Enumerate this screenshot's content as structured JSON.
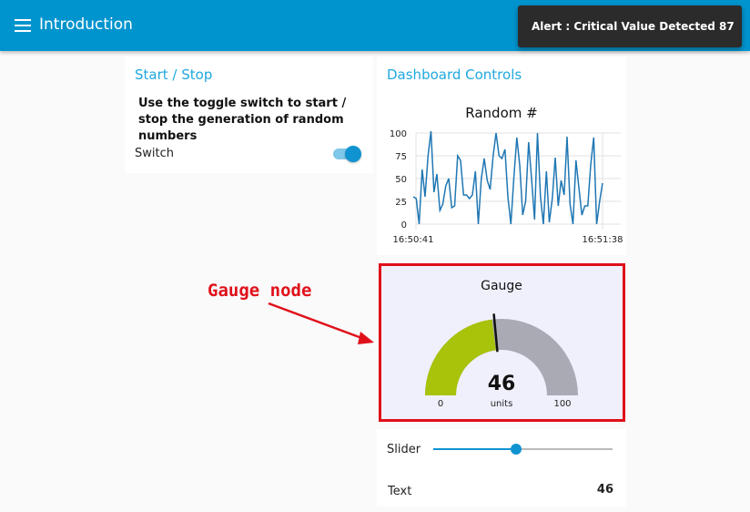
{
  "header": {
    "title": "Introduction",
    "menu_icon": "hamburger-menu-icon",
    "accent_color": "#0094ce"
  },
  "toast": {
    "message": "Alert : Critical Value Detected 87"
  },
  "start_stop": {
    "title": "Start / Stop",
    "description": "Use the toggle switch to start / stop the generation of random numbers",
    "switch_label": "Switch",
    "switch_on": true
  },
  "dashboard": {
    "title": "Dashboard Controls"
  },
  "chart_data": {
    "type": "line",
    "title": "Random #",
    "xlabel": "",
    "ylabel": "",
    "x_tick_labels": [
      "16:50:41",
      "16:51:38"
    ],
    "y_ticks": [
      0,
      25,
      50,
      75,
      100
    ],
    "ylim": [
      0,
      100
    ],
    "grid": true,
    "color": "#1f77b4",
    "values": [
      30,
      28,
      0,
      60,
      30,
      75,
      102,
      35,
      55,
      15,
      22,
      42,
      50,
      18,
      20,
      75,
      70,
      32,
      32,
      28,
      32,
      58,
      0,
      50,
      72,
      48,
      38,
      75,
      100,
      75,
      72,
      82,
      30,
      0,
      50,
      95,
      65,
      10,
      25,
      90,
      50,
      5,
      100,
      30,
      0,
      58,
      2,
      28,
      73,
      20,
      48,
      32,
      96,
      22,
      0,
      70,
      40,
      10,
      20,
      20,
      65,
      95,
      0,
      25,
      45
    ]
  },
  "gauge": {
    "title": "Gauge",
    "value": 46,
    "units": "units",
    "min": 0,
    "max": 100,
    "fill_color": "#a9c20a",
    "track_color": "#aaaab4",
    "needle_value": 47
  },
  "slider": {
    "label": "Slider",
    "value": 46,
    "min": 0,
    "max": 100
  },
  "text_widget": {
    "label": "Text",
    "value": "46"
  },
  "annotation": {
    "label": "Gauge node",
    "color": "#e0101a"
  }
}
